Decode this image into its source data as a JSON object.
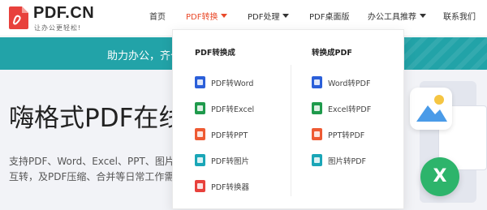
{
  "header": {
    "logo_text": "PDF.CN",
    "logo_slogan": "让办公更轻松!",
    "nav": [
      {
        "label": "首页",
        "active": false,
        "caret": false
      },
      {
        "label": "PDF转换",
        "active": true,
        "caret": true
      },
      {
        "label": "PDF处理",
        "active": false,
        "caret": true
      },
      {
        "label": "PDF桌面版",
        "active": false,
        "caret": false
      },
      {
        "label": "办公工具推荐",
        "active": false,
        "caret": true
      },
      {
        "label": "联系我们",
        "active": false,
        "caret": false
      }
    ]
  },
  "banner": {
    "text": "助力办公，齐个"
  },
  "hero": {
    "title": "嗨格式PDF在线",
    "desc_line1": "支持PDF、Word、Excel、PPT、图片",
    "desc_line2": "互转，及PDF压缩、合并等日常工作需"
  },
  "dropdown": {
    "col1": {
      "heading": "PDF转换成",
      "items": [
        {
          "label": "PDF转Word",
          "icon": "word-icon",
          "color": "#2b5fd9"
        },
        {
          "label": "PDF转Excel",
          "icon": "excel-icon",
          "color": "#1f9a4c"
        },
        {
          "label": "PDF转PPT",
          "icon": "ppt-icon",
          "color": "#ee5a33"
        },
        {
          "label": "PDF转图片",
          "icon": "image-icon",
          "color": "#1aa6b7"
        },
        {
          "label": "PDF转换器",
          "icon": "pdf-converter-icon",
          "color": "#e8413c"
        }
      ]
    },
    "col2": {
      "heading": "转换成PDF",
      "items": [
        {
          "label": "Word转PDF",
          "icon": "word-icon",
          "color": "#2b5fd9"
        },
        {
          "label": "Excel转PDF",
          "icon": "excel-icon",
          "color": "#1f9a4c"
        },
        {
          "label": "PPT转PDF",
          "icon": "ppt-icon",
          "color": "#ee5a33"
        },
        {
          "label": "图片转PDF",
          "icon": "image-icon",
          "color": "#1aa6b7"
        }
      ]
    }
  },
  "colors": {
    "accent": "#e94a2a",
    "banner": "#22a3a8",
    "excel_badge": "#2db46b"
  }
}
